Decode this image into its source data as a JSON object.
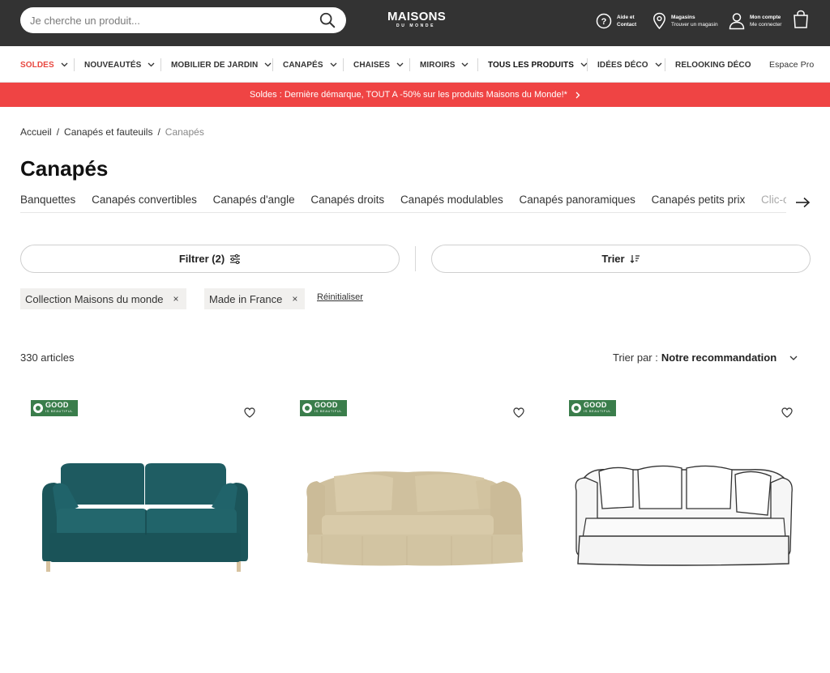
{
  "header": {
    "search_placeholder": "Je cherche un produit...",
    "logo_line1": "MAISONS",
    "logo_line2": "DU MONDE",
    "help": {
      "line1": "Aide et",
      "line2": "Contact"
    },
    "stores": {
      "line1": "Magasins",
      "line2": "Trouver un magasin"
    },
    "account": {
      "line1": "Mon compte",
      "line2": "Me connecter"
    }
  },
  "nav": {
    "items": [
      {
        "label": "SOLDES",
        "chevron": true,
        "color": "#e8473f"
      },
      {
        "label": "NOUVEAUTÉS",
        "chevron": true
      },
      {
        "label": "MOBILIER DE JARDIN",
        "chevron": true
      },
      {
        "label": "CANAPÉS",
        "chevron": true
      },
      {
        "label": "CHAISES",
        "chevron": true
      },
      {
        "label": "MIROIRS",
        "chevron": true
      },
      {
        "label": "TOUS LES PRODUITS",
        "chevron": true
      },
      {
        "label": "IDÉES DÉCO",
        "chevron": true
      },
      {
        "label": "RELOOKING DÉCO",
        "chevron": false
      }
    ],
    "pro_label": "Espace Pro"
  },
  "promo": {
    "text": "Soldes : Dernière démarque, TOUT A -50% sur les produits Maisons du Monde!*",
    "color": "#ef4444"
  },
  "breadcrumb": {
    "items": [
      "Accueil",
      "/",
      "Canapés et fauteuils",
      "/",
      "Canapés"
    ]
  },
  "page": {
    "title": "Canapés"
  },
  "subcategories": [
    "Banquettes",
    "Canapés convertibles",
    "Canapés d'angle",
    "Canapés droits",
    "Canapés modulables",
    "Canapés panoramiques",
    "Canapés petits prix",
    "Clic-clac"
  ],
  "filters": {
    "filter_label": "Filtrer (2)",
    "sort_label": "Trier",
    "chips": [
      "Collection Maisons du monde",
      "Made in France"
    ],
    "chip_remove": "×",
    "reset_label": "Réinitialiser"
  },
  "results": {
    "count": "330 articles",
    "sort_prefix": "Trier par :",
    "sort_value": "Notre recommandation"
  },
  "products": [
    {
      "badge_title": "GOOD",
      "badge_sub": "IS BEAUTIFUL",
      "color": "#1f5d63"
    },
    {
      "badge_title": "GOOD",
      "badge_sub": "IS BEAUTIFUL",
      "color": "#d9cbaa"
    },
    {
      "badge_title": "GOOD",
      "badge_sub": "IS BEAUTIFUL",
      "color": "#f7f7f7"
    }
  ]
}
